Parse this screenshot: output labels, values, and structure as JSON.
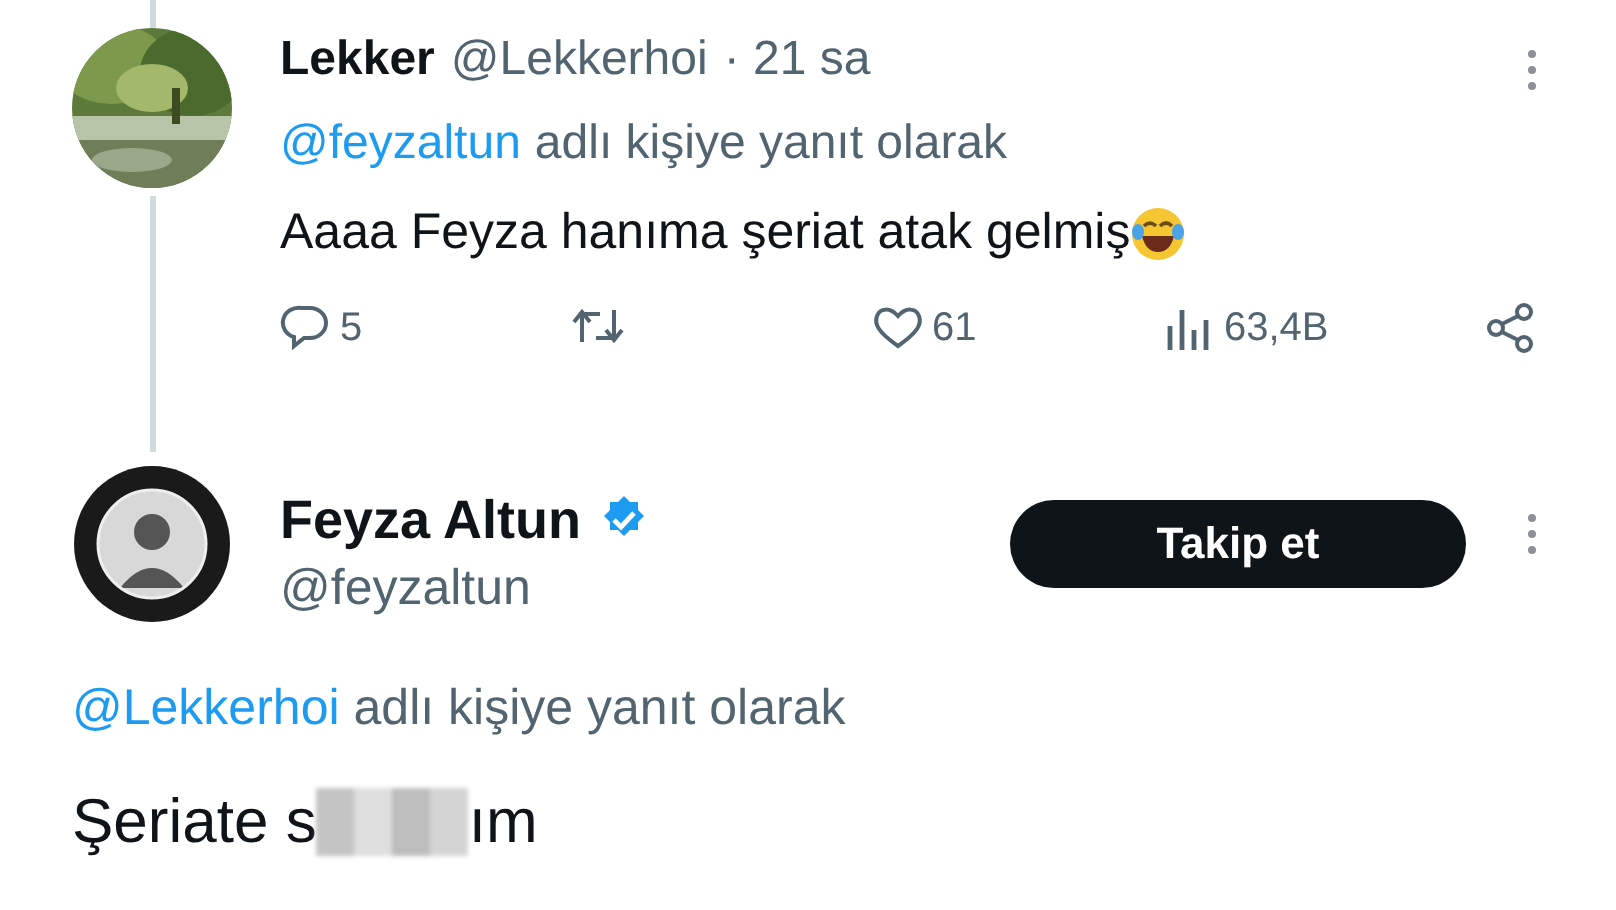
{
  "reply_tweet": {
    "author": "Lekker",
    "handle": "@Lekkerhoi",
    "time": "· 21 sa",
    "reply_to": {
      "mention": "@feyzaltun",
      "text": "adlı kişiye yanıt olarak"
    },
    "text": "Aaaa Feyza hanıma şeriat atak gelmiş",
    "stats": [
      {
        "kind": "reply",
        "count": "5"
      },
      {
        "kind": "retweet"
      },
      {
        "kind": "like",
        "count": "61"
      },
      {
        "kind": "views",
        "count": "63,4B"
      },
      {
        "kind": "share"
      }
    ]
  },
  "main_tweet": {
    "author": "Feyza Altun",
    "verified": true,
    "handle": "@feyzaltun",
    "follow_button": "Takip et",
    "reply_to": {
      "mention": "@Lekkerhoi",
      "text": "adlı kişiye yanıt olarak"
    },
    "text_before": "Şeriate s",
    "censored": true,
    "text_after": "ım"
  }
}
